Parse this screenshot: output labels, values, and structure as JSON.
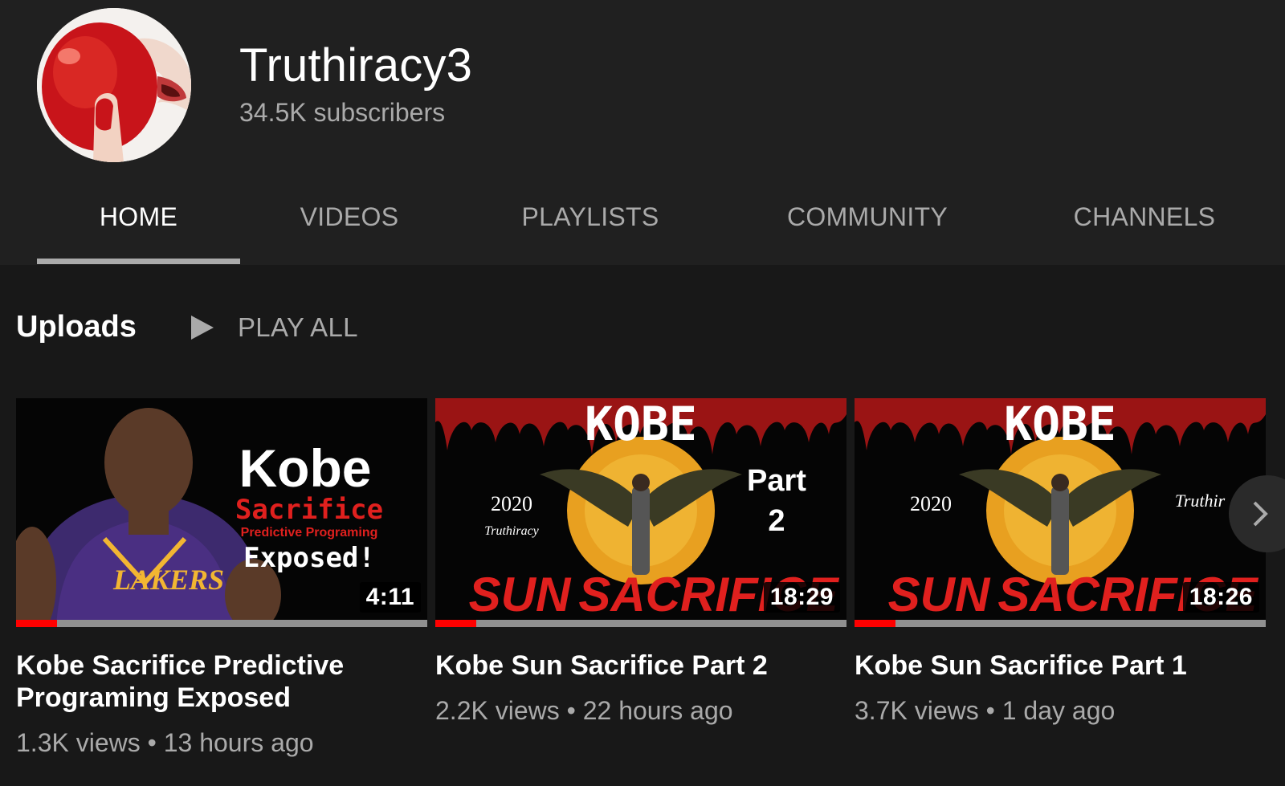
{
  "channel": {
    "name": "Truthiracy3",
    "subscribers": "34.5K subscribers"
  },
  "tabs": [
    {
      "label": "HOME",
      "active": true
    },
    {
      "label": "VIDEOS",
      "active": false
    },
    {
      "label": "PLAYLISTS",
      "active": false
    },
    {
      "label": "COMMUNITY",
      "active": false
    },
    {
      "label": "CHANNELS",
      "active": false
    }
  ],
  "uploads": {
    "title": "Uploads",
    "play_all": "PLAY ALL",
    "play_icon": "play-icon",
    "next_icon": "chevron-right-icon"
  },
  "videos": [
    {
      "title": "Kobe Sacrifice Predictive Programing Exposed",
      "meta": "1.3K views • 13 hours ago",
      "duration": "4:11",
      "watched_fraction": 0.1,
      "thumb_text": {
        "big": "Kobe",
        "red": "Sacrifice",
        "small": "Predictive Programing",
        "bottom": "Exposed!",
        "jersey": "LAKERS"
      }
    },
    {
      "title": "Kobe Sun Sacrifice Part 2",
      "meta": "2.2K views • 22 hours ago",
      "duration": "18:29",
      "watched_fraction": 0.1,
      "thumb_text": {
        "top": "KOBE",
        "year": "2020",
        "brand": "Truthiracy",
        "part": "Part",
        "part_num": "2",
        "bottom_left": "SUN",
        "bottom_right": "SACRIFICE"
      }
    },
    {
      "title": "Kobe Sun Sacrifice Part 1",
      "meta": "3.7K views • 1 day ago",
      "duration": "18:26",
      "watched_fraction": 0.1,
      "thumb_text": {
        "top": "KOBE",
        "year": "2020",
        "brand": "Truthir",
        "bottom_left": "SUN",
        "bottom_right": "SACRIFICE"
      }
    }
  ],
  "colors": {
    "background": "#181818",
    "header": "#202020",
    "accent_red": "#ff0000",
    "muted_text": "#aaaaaa"
  }
}
